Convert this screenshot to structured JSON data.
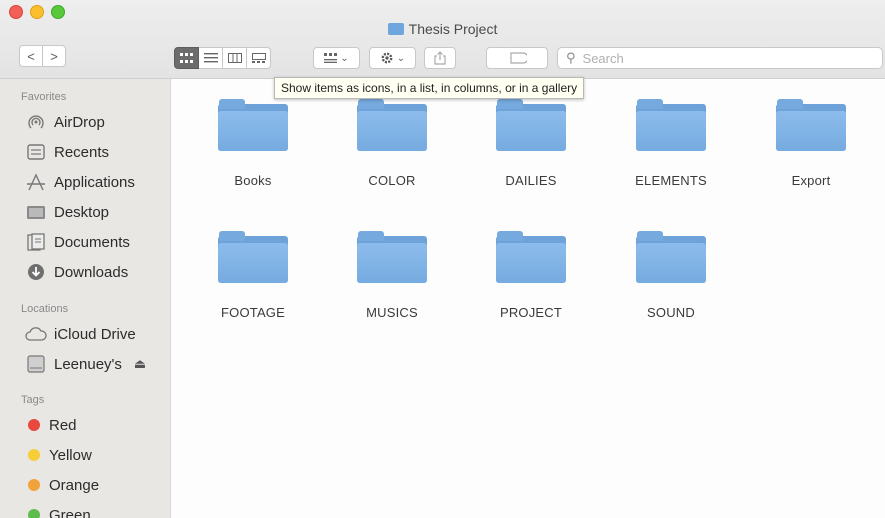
{
  "window": {
    "title": "Thesis Project"
  },
  "toolbar": {
    "back_label": "<",
    "forward_label": ">",
    "search_placeholder": "Search",
    "tooltip": "Show items as icons, in a list, in columns, or in a gallery",
    "arrow_glyph": "⌄"
  },
  "sidebar": {
    "favorites_header": "Favorites",
    "favorites": [
      {
        "label": "AirDrop",
        "icon": "airdrop-icon"
      },
      {
        "label": "Recents",
        "icon": "recents-icon"
      },
      {
        "label": "Applications",
        "icon": "applications-icon"
      },
      {
        "label": "Desktop",
        "icon": "desktop-icon"
      },
      {
        "label": "Documents",
        "icon": "documents-icon"
      },
      {
        "label": "Downloads",
        "icon": "downloads-icon"
      }
    ],
    "locations_header": "Locations",
    "locations": [
      {
        "label": "iCloud Drive",
        "icon": "cloud-icon"
      },
      {
        "label": "Leenuey's",
        "icon": "disk-icon",
        "eject": "⏏"
      }
    ],
    "tags_header": "Tags",
    "tags": [
      {
        "label": "Red",
        "color": "#e8493f"
      },
      {
        "label": "Yellow",
        "color": "#f7cd38"
      },
      {
        "label": "Orange",
        "color": "#f2a23a"
      },
      {
        "label": "Green",
        "color": "#5cbd4c"
      }
    ]
  },
  "folders": [
    {
      "name": "Books"
    },
    {
      "name": "COLOR"
    },
    {
      "name": "DAILIES"
    },
    {
      "name": "ELEMENTS"
    },
    {
      "name": "Export"
    },
    {
      "name": "FOOTAGE"
    },
    {
      "name": "MUSICS"
    },
    {
      "name": "PROJECT"
    },
    {
      "name": "SOUND"
    }
  ],
  "colors": {
    "folder": "#7aaee2",
    "active_view_button": "#6c6c6c"
  }
}
